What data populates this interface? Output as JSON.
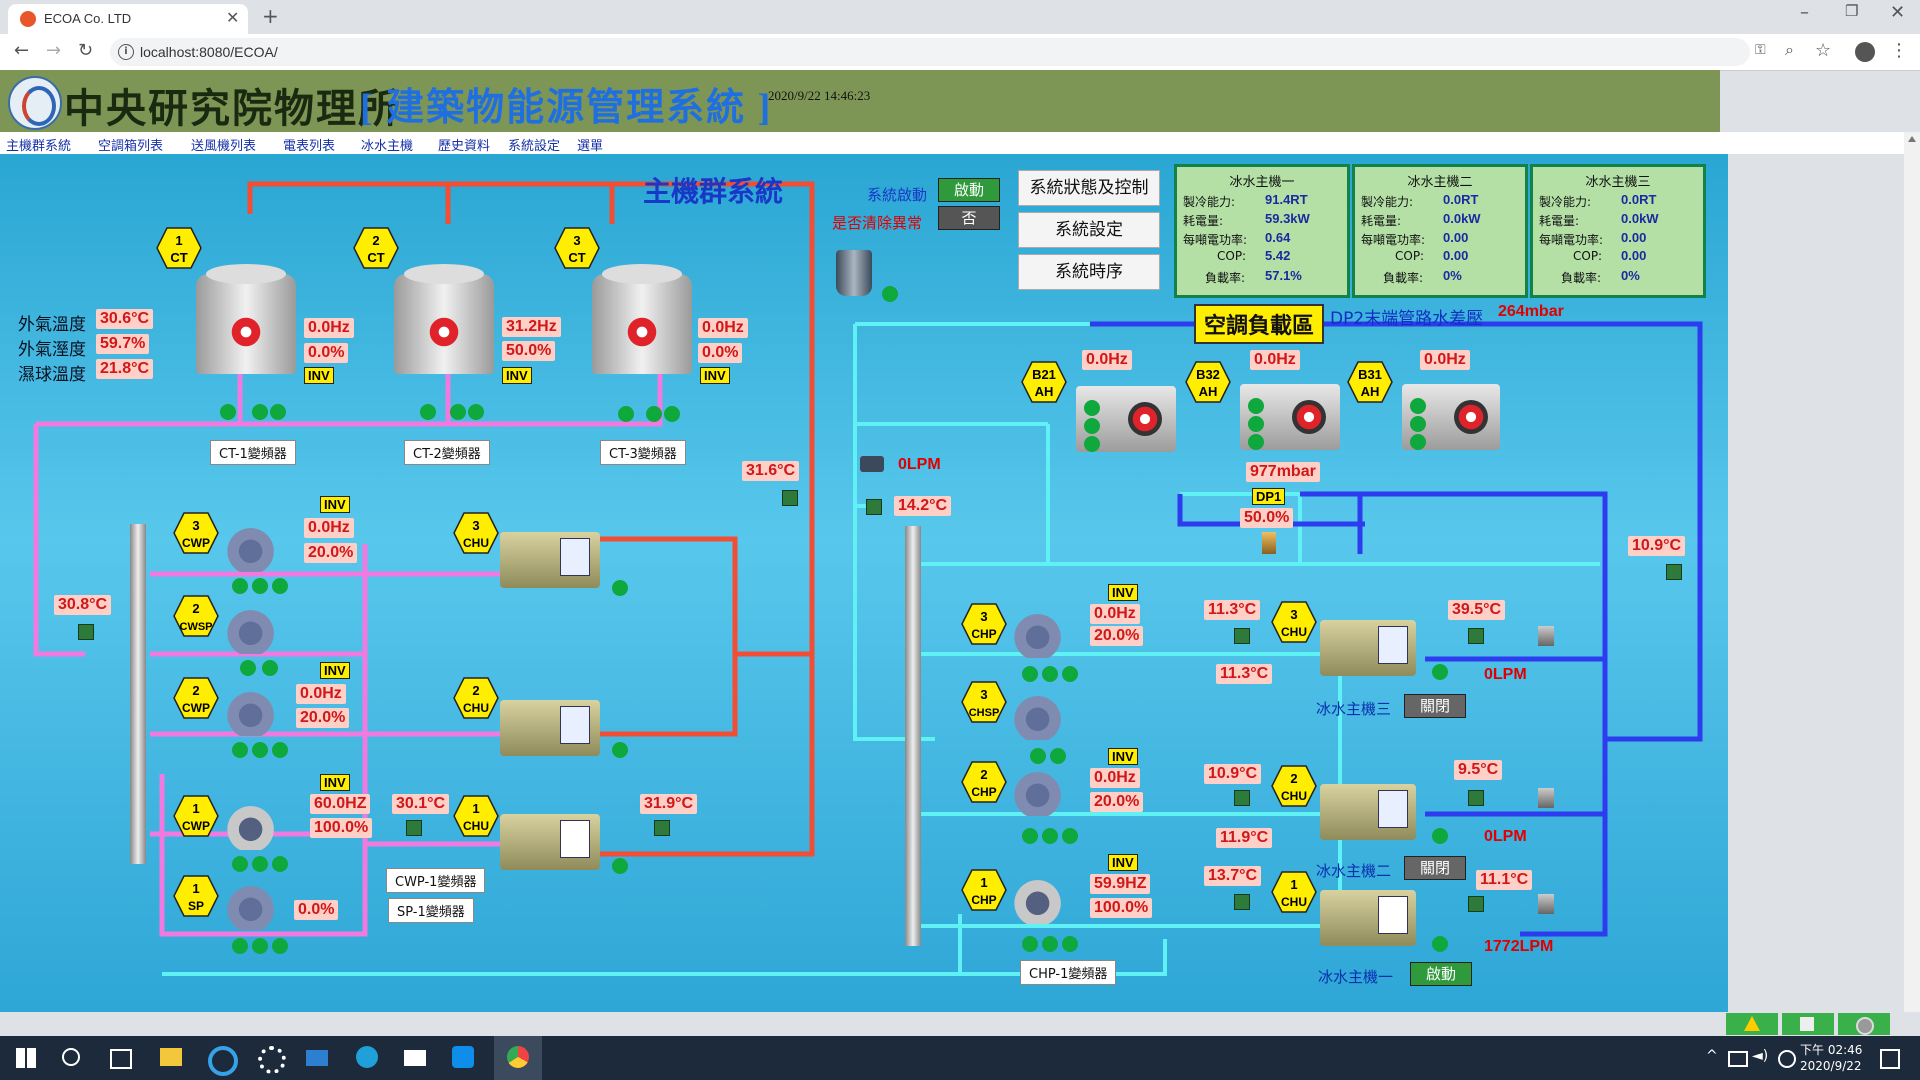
{
  "browser": {
    "tab_title": "ECOA Co. LTD",
    "new_tab_icon": "plus-icon",
    "url": "localhost:8080/ECOA/"
  },
  "app": {
    "title": "中央研究院物理所",
    "subtitle": "[ 建築物能源管理系統 ]",
    "datetime": "2020/9/22 14:46:23",
    "menu": [
      "主機群系統",
      "空調箱列表",
      "送風機列表",
      "電表列表",
      "冰水主機",
      "歷史資料",
      "系統設定",
      "選單"
    ],
    "page_title": "主機群系統"
  },
  "controls": {
    "system_start_label": "系統啟動",
    "system_start_value": "啟動",
    "clear_alarm_label": "是否清除異常",
    "clear_alarm_value": "否",
    "status_button": "系統狀態及控制",
    "settings_button": "系統設定",
    "schedule_button": "系統時序"
  },
  "chiller_panels": [
    {
      "title": "冰水主機一",
      "rows": [
        [
          "製冷能力:",
          "91.4RT"
        ],
        [
          "耗電量:",
          "59.3kW"
        ],
        [
          "每噸電功率:",
          "0.64"
        ],
        [
          "COP:",
          "5.42"
        ],
        [
          "負載率:",
          "57.1%"
        ]
      ]
    },
    {
      "title": "冰水主機二",
      "rows": [
        [
          "製冷能力:",
          "0.0RT"
        ],
        [
          "耗電量:",
          "0.0kW"
        ],
        [
          "每噸電功率:",
          "0.00"
        ],
        [
          "COP:",
          "0.00"
        ],
        [
          "負載率:",
          "0%"
        ]
      ]
    },
    {
      "title": "冰水主機三",
      "rows": [
        [
          "製冷能力:",
          "0.0RT"
        ],
        [
          "耗電量:",
          "0.0kW"
        ],
        [
          "每噸電功率:",
          "0.00"
        ],
        [
          "COP:",
          "0.00"
        ],
        [
          "負載率:",
          "0%"
        ]
      ]
    }
  ],
  "weather": {
    "outdoor_temp_label": "外氣溫度",
    "outdoor_temp": "30.6°C",
    "outdoor_humidity_label": "外氣溼度",
    "outdoor_humidity": "59.7%",
    "wet_bulb_label": "濕球溫度",
    "wet_bulb": "21.8°C"
  },
  "cooling_towers": [
    {
      "num": "1",
      "type": "CT",
      "freq": "0.0Hz",
      "pct": "0.0%",
      "inv": "INV",
      "vfd": "CT-1變頻器"
    },
    {
      "num": "2",
      "type": "CT",
      "freq": "31.2Hz",
      "pct": "50.0%",
      "inv": "INV",
      "vfd": "CT-2變頻器"
    },
    {
      "num": "3",
      "type": "CT",
      "freq": "0.0Hz",
      "pct": "0.0%",
      "inv": "INV",
      "vfd": "CT-3變頻器"
    }
  ],
  "load_zone": {
    "title": "空調負載區",
    "dp2_label": "DP2末端管路水差壓",
    "dp2_value": "264mbar",
    "ahus": [
      {
        "name": "B21",
        "type": "AH",
        "freq": "0.0Hz"
      },
      {
        "name": "B32",
        "type": "AH",
        "freq": "0.0Hz"
      },
      {
        "name": "B31",
        "type": "AH",
        "freq": "0.0Hz"
      }
    ],
    "dp1_label": "DP1",
    "dp1_pressure": "977mbar",
    "dp1_valve": "50.0%"
  },
  "condenser_side": {
    "pumps": [
      {
        "num": "3",
        "type": "CWP",
        "inv": "INV",
        "freq": "0.0Hz",
        "pct": "20.0%"
      },
      {
        "num": "2",
        "type": "CWSP"
      },
      {
        "num": "2",
        "type": "CWP",
        "inv": "INV",
        "freq": "0.0Hz",
        "pct": "20.0%"
      },
      {
        "num": "1",
        "type": "CWP",
        "inv": "INV",
        "freq": "60.0HZ",
        "pct": "100.0%"
      },
      {
        "num": "1",
        "type": "SP",
        "pct": "0.0%"
      }
    ],
    "chillers": [
      {
        "num": "3",
        "type": "CHU"
      },
      {
        "num": "2",
        "type": "CHU"
      },
      {
        "num": "1",
        "type": "CHU"
      }
    ],
    "temp_return": "31.6°C",
    "temp_left": "30.8°C",
    "temp_ch1_in": "30.1°C",
    "temp_ch1_out": "31.9°C",
    "cwp1_vfd": "CWP-1變頻器",
    "sp1_vfd": "SP-1變頻器"
  },
  "chilled_side": {
    "flow_main": "0LPM",
    "temp_main": "14.2°C",
    "temp_right": "10.9°C",
    "pumps": [
      {
        "num": "3",
        "type": "CHP",
        "inv": "INV",
        "freq": "0.0Hz",
        "pct": "20.0%"
      },
      {
        "num": "3",
        "type": "CHSP"
      },
      {
        "num": "2",
        "type": "CHP",
        "inv": "INV",
        "freq": "0.0Hz",
        "pct": "20.0%"
      },
      {
        "num": "1",
        "type": "CHP",
        "inv": "INV",
        "freq": "59.9HZ",
        "pct": "100.0%"
      }
    ],
    "chp1_vfd": "CHP-1變頻器",
    "chillers": [
      {
        "num": "3",
        "type": "CHU",
        "in_temp": "11.3°C",
        "in_temp2": "11.3°C",
        "out_temp": "39.5°C",
        "flow": "0LPM",
        "name": "冰水主機三",
        "state": "關閉"
      },
      {
        "num": "2",
        "type": "CHU",
        "in_temp": "10.9°C",
        "in_temp2": "11.9°C",
        "out_temp": "9.5°C",
        "flow": "0LPM",
        "name": "冰水主機二",
        "state": "關閉"
      },
      {
        "num": "1",
        "type": "CHU",
        "in_temp": "13.7°C",
        "out_temp": "11.1°C",
        "flow": "1772LPM",
        "name": "冰水主機一",
        "state": "啟動"
      }
    ]
  },
  "taskbar": {
    "time": "下午 02:46",
    "date": "2020/9/22"
  }
}
